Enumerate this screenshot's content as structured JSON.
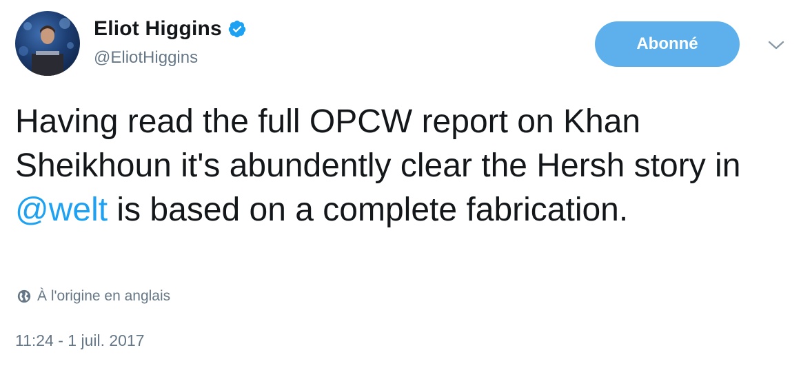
{
  "author": {
    "display_name": "Eliot Higgins",
    "handle": "@EliotHiggins",
    "verified": true
  },
  "follow_button": {
    "label": "Abonné"
  },
  "tweet": {
    "text_before": "Having read the full OPCW report on Khan Sheikhoun it's abundently clear the Hersh story in ",
    "mention": "@welt",
    "text_after": " is based on a complete fabrication."
  },
  "translation": {
    "label": "À l'origine en anglais"
  },
  "timestamp": "11:24 - 1 juil. 2017",
  "icons": {
    "verified": "verified-badge-icon",
    "more": "chevron-down-icon",
    "globe": "globe-icon"
  },
  "colors": {
    "accent": "#1da1f2",
    "follow_button": "#5db0ec",
    "secondary_text": "#657786",
    "primary_text": "#14171a"
  }
}
